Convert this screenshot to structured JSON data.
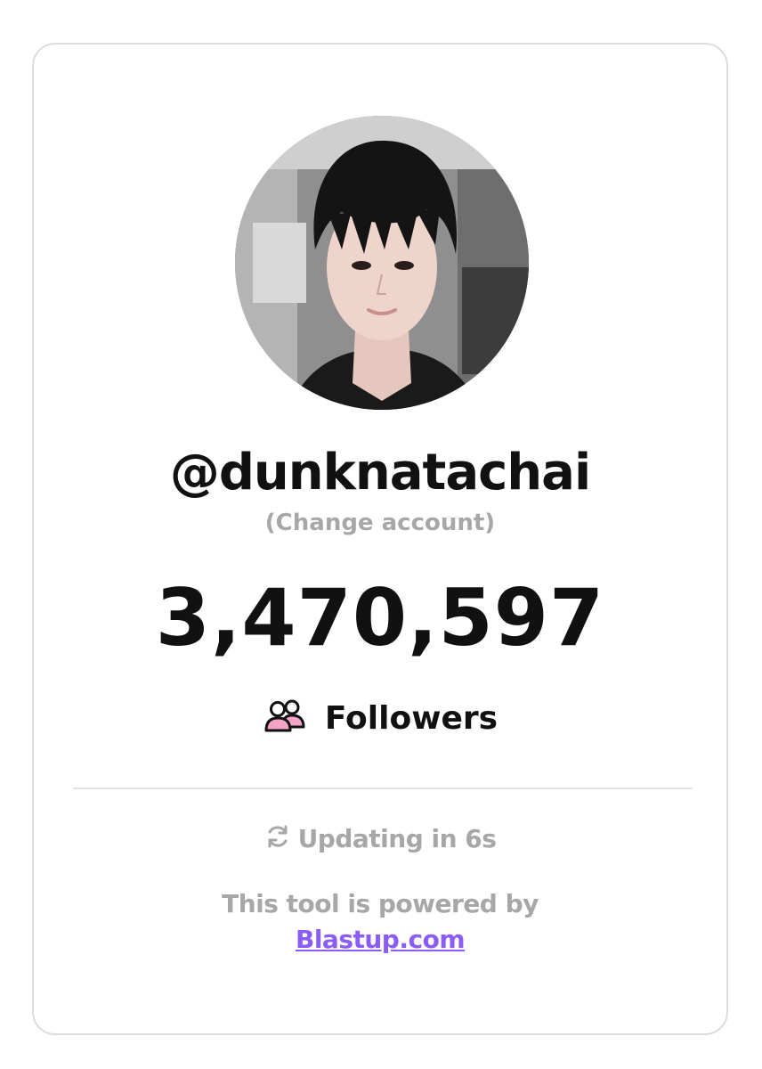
{
  "profile": {
    "username": "@dunknatachai",
    "change_account_label": "(Change account)"
  },
  "stats": {
    "follower_count": "3,470,597",
    "followers_label": "Followers",
    "followers_icon": "users-icon"
  },
  "footer": {
    "updating_icon": "refresh-icon",
    "updating_text": "Updating in 6s",
    "powered_by_text": "This tool is powered by",
    "link_text": "Blastup.com"
  },
  "colors": {
    "text_primary": "#111111",
    "text_muted": "#a7a7a7",
    "link": "#8b5cf6",
    "icon_accent": "#f5a3c7",
    "border": "#dcdcdc"
  }
}
